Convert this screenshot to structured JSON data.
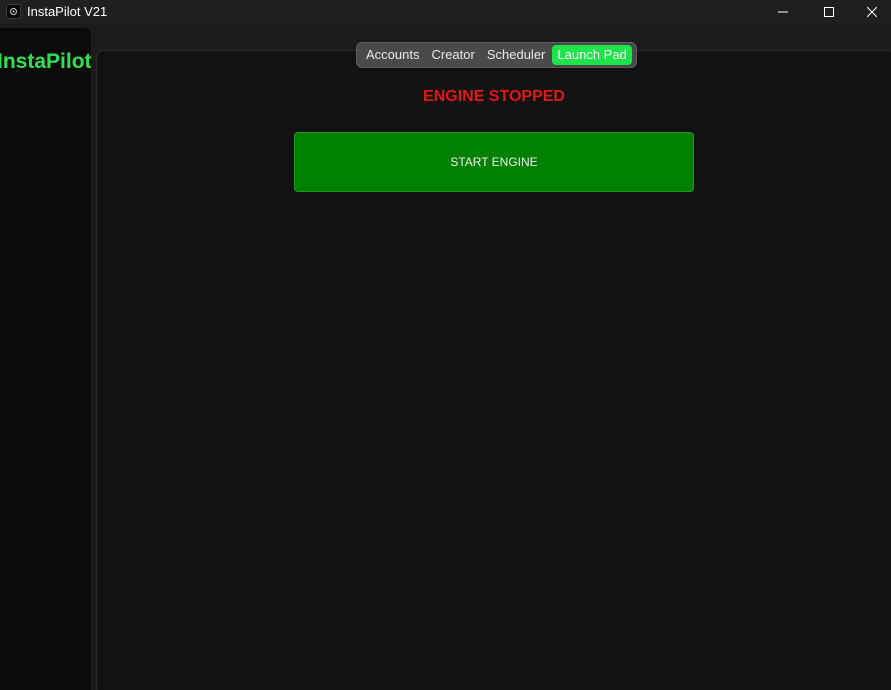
{
  "window": {
    "title": "InstaPilot V21",
    "controls": [
      "minimize-icon",
      "maximize-icon",
      "close-icon"
    ]
  },
  "sidebar": {
    "logo": "InstaPilot"
  },
  "tabs": {
    "items": [
      {
        "label": "Accounts",
        "active": false
      },
      {
        "label": "Creator",
        "active": false
      },
      {
        "label": "Scheduler",
        "active": false
      },
      {
        "label": "Launch Pad",
        "active": true
      }
    ]
  },
  "launch_pad": {
    "status_text": "ENGINE STOPPED",
    "start_button_label": "START ENGINE"
  },
  "colors": {
    "accent_green": "#1fe34a",
    "logo_green": "#2fe04f",
    "status_red": "#e01818",
    "start_button_green": "#008000"
  }
}
